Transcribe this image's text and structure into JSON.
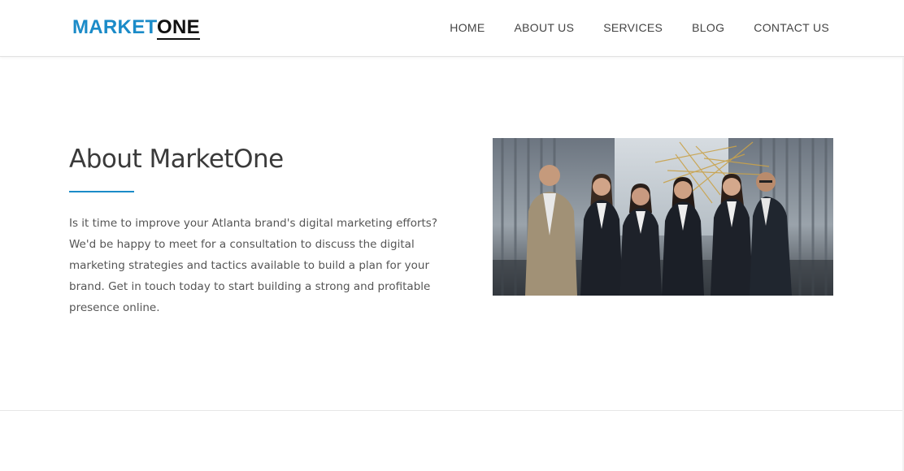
{
  "header": {
    "logo_part1": "MARKET",
    "logo_part2": "ONE",
    "nav": [
      {
        "label": "HOME"
      },
      {
        "label": "ABOUT US"
      },
      {
        "label": "SERVICES"
      },
      {
        "label": "BLOG"
      },
      {
        "label": "CONTACT US"
      }
    ]
  },
  "about": {
    "title": "About MarketOne",
    "body": "Is it time to improve your Atlanta brand's digital marketing efforts? We'd be happy to meet for a consultation to discuss the digital marketing strategies and tactics available to build a plan for your brand. Get in touch today to start building a strong and profitable presence online."
  },
  "colors": {
    "accent": "#1b8bc8",
    "text_dark": "#3a3a3a",
    "text_body": "#555555"
  }
}
